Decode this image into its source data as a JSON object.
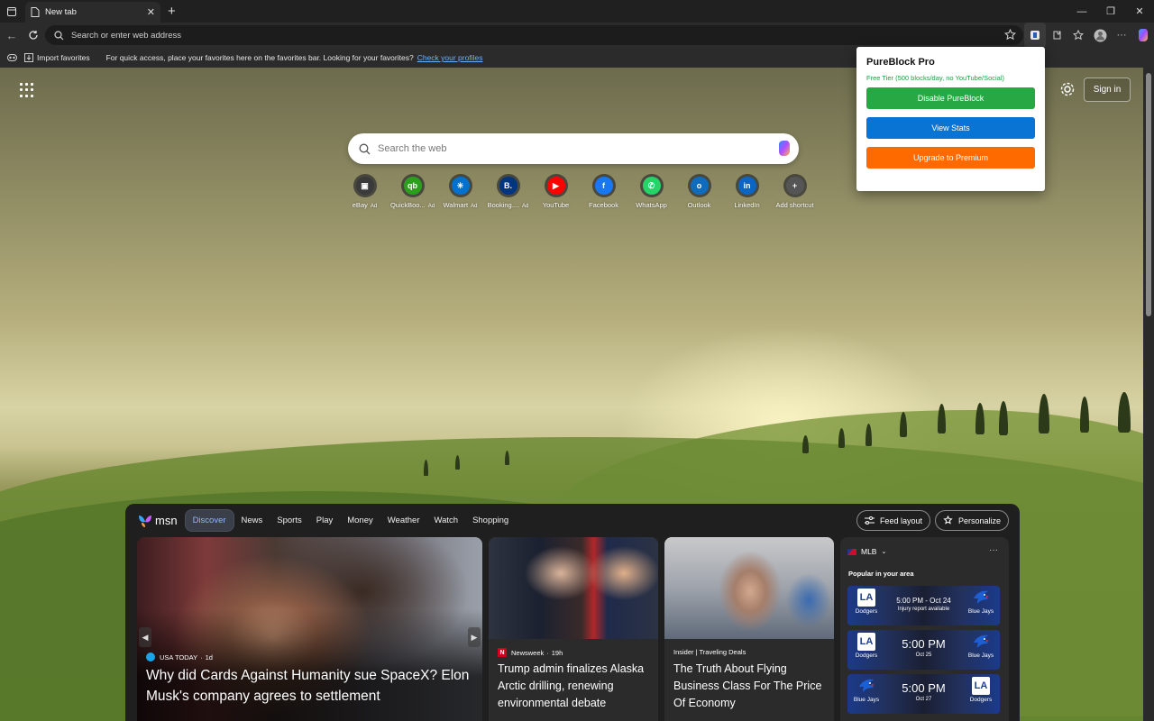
{
  "browser": {
    "tab": {
      "title": "New tab"
    },
    "address": {
      "placeholder": "Search or enter web address"
    },
    "favorites_bar": {
      "import_label": "Import favorites",
      "hint": "For quick access, place your favorites here on the favorites bar. Looking for your favorites?",
      "link": "Check your profiles"
    }
  },
  "ntp": {
    "sign_in": "Sign in",
    "search_placeholder": "Search the web",
    "shortcuts": [
      {
        "label": "eBay",
        "ad": "Ad",
        "icon": "ebay-icon",
        "color": "#3a3a3a"
      },
      {
        "label": "QuickBoo...",
        "ad": "Ad",
        "icon": "quickbooks-icon",
        "color": "#2ca01c"
      },
      {
        "label": "Walmart",
        "ad": "Ad",
        "icon": "walmart-icon",
        "color": "#0071ce"
      },
      {
        "label": "Booking....",
        "ad": "Ad",
        "icon": "booking-icon",
        "color": "#003580"
      },
      {
        "label": "YouTube",
        "ad": "",
        "icon": "youtube-icon",
        "color": "#ff0000"
      },
      {
        "label": "Facebook",
        "ad": "",
        "icon": "facebook-icon",
        "color": "#1877f2"
      },
      {
        "label": "WhatsApp",
        "ad": "",
        "icon": "whatsapp-icon",
        "color": "#25d366"
      },
      {
        "label": "Outlook",
        "ad": "",
        "icon": "outlook-icon",
        "color": "#0f6cbd"
      },
      {
        "label": "LinkedIn",
        "ad": "",
        "icon": "linkedin-icon",
        "color": "#0a66c2"
      },
      {
        "label": "Add shortcut",
        "ad": "",
        "icon": "plus-icon",
        "color": "#555555"
      }
    ]
  },
  "popup": {
    "title": "PureBlock Pro",
    "tier": "Free Tier (500 blocks/day, no YouTube/Social)",
    "buttons": {
      "disable": "Disable PureBlock",
      "stats": "View Stats",
      "upgrade": "Upgrade to Premium"
    },
    "colors": {
      "disable": "#28a745",
      "stats": "#0a74d4",
      "upgrade": "#ff6a00"
    }
  },
  "feed": {
    "logo": "msn",
    "tabs": [
      "Discover",
      "News",
      "Sports",
      "Play",
      "Money",
      "Weather",
      "Watch",
      "Shopping"
    ],
    "active_tab": "Discover",
    "feed_layout": "Feed layout",
    "personalize": "Personalize",
    "hero": {
      "source": "USA TODAY",
      "age": "1d",
      "title": "Why did Cards Against Humanity sue SpaceX? Elon Musk's company agrees to settlement"
    },
    "cards": [
      {
        "source": "Newsweek",
        "age": "19h",
        "title": "Trump admin finalizes Alaska Arctic drilling, renewing environmental debate"
      },
      {
        "source": "Insider | Traveling Deals",
        "age": "",
        "title": "The Truth About Flying Business Class For The Price Of Economy"
      }
    ],
    "mlb": {
      "league": "MLB",
      "subtitle": "Popular in your area",
      "games": [
        {
          "left": "Dodgers",
          "right": "Blue Jays",
          "time": "5:00 PM - Oct 24",
          "note": "Injury report available",
          "big": false
        },
        {
          "left": "Dodgers",
          "right": "Blue Jays",
          "time": "5:00 PM",
          "note": "Oct 25",
          "big": true
        },
        {
          "left": "Blue Jays",
          "right": "Dodgers",
          "time": "5:00 PM",
          "note": "Oct 27",
          "big": true
        }
      ]
    }
  }
}
